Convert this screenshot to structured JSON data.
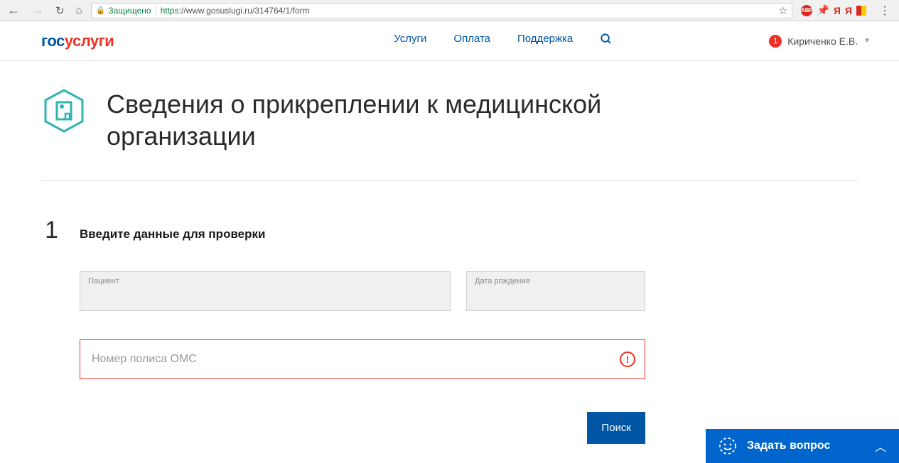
{
  "browser": {
    "secure_label": "Защищено",
    "url_https": "https",
    "url_rest": "://www.gosuslugi.ru/314764/1/form",
    "abp": "ABP",
    "ya": "Я"
  },
  "header": {
    "logo_part1": "гос",
    "logo_part2": "услуги",
    "nav": {
      "services": "Услуги",
      "payment": "Оплата",
      "support": "Поддержка"
    },
    "notif_count": "1",
    "user_name": "Кириченко Е.В."
  },
  "page": {
    "title": "Сведения о прикреплении к медицинской организации",
    "step_num": "1",
    "step_title": "Введите данные для проверки",
    "patient_label": "Пациент",
    "dob_label": "Дата рождения",
    "oms_placeholder": "Номер полиса ОМС",
    "search_btn": "Поиск"
  },
  "chat": {
    "label": "Задать вопрос"
  }
}
